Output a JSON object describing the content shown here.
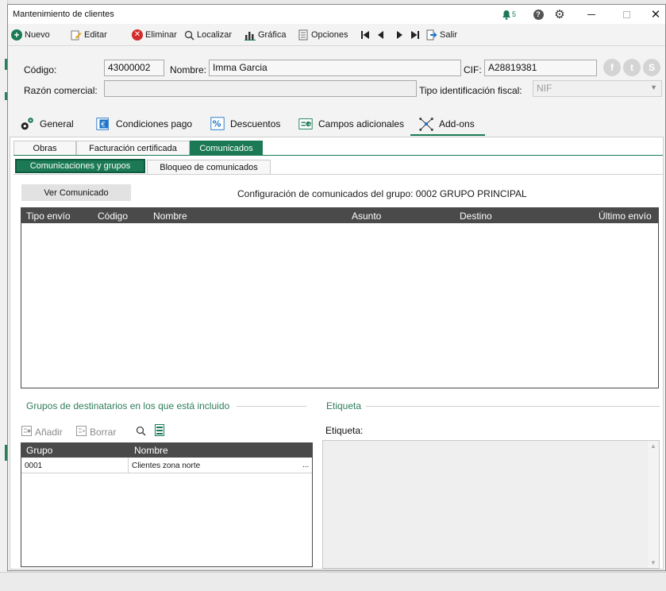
{
  "window": {
    "title": "Mantenimiento de clientes",
    "notification_count": "5"
  },
  "toolbar": {
    "nuevo": "Nuevo",
    "editar": "Editar",
    "eliminar": "Eliminar",
    "localizar": "Localizar",
    "grafica": "Gráfica",
    "opciones": "Opciones",
    "salir": "Salir"
  },
  "form": {
    "codigo_label": "Código:",
    "codigo_value": "43000002",
    "nombre_label": "Nombre:",
    "nombre_value": "Imma Garcia",
    "cif_label": "CIF:",
    "cif_value": "A28819381",
    "razon_label": "Razón comercial:",
    "razon_value": "",
    "tipo_label": "Tipo identificación fiscal:",
    "tipo_value": "NIF"
  },
  "tabs": [
    {
      "label": "General"
    },
    {
      "label": "Condiciones pago"
    },
    {
      "label": "Descuentos"
    },
    {
      "label": "Campos adicionales"
    },
    {
      "label": "Add-ons"
    }
  ],
  "subtabs": [
    "Obras",
    "Facturación certificada",
    "Comunicados"
  ],
  "subsubtabs": [
    "Comunicaciones y grupos",
    "Bloqueo de comunicados"
  ],
  "comunicados": {
    "ver_button": "Ver Comunicado",
    "config_text": "Configuración de comunicados del grupo: 0002 GRUPO PRINCIPAL",
    "columns": [
      "Tipo envío",
      "Código",
      "Nombre",
      "Asunto",
      "Destino",
      "Último envío"
    ]
  },
  "grupos": {
    "title": "Grupos de destinatarios en los que está incluido",
    "add_label": "Añadir",
    "delete_label": "Borrar",
    "columns": [
      "Grupo",
      "Nombre"
    ],
    "rows": [
      {
        "grupo": "0001",
        "nombre": "Clientes zona norte",
        "more": "..."
      }
    ]
  },
  "etiqueta": {
    "section_title": "Etiqueta",
    "label": "Etiqueta:"
  },
  "colors": {
    "accent": "#1b7a55",
    "header": "#4a4a4a"
  }
}
